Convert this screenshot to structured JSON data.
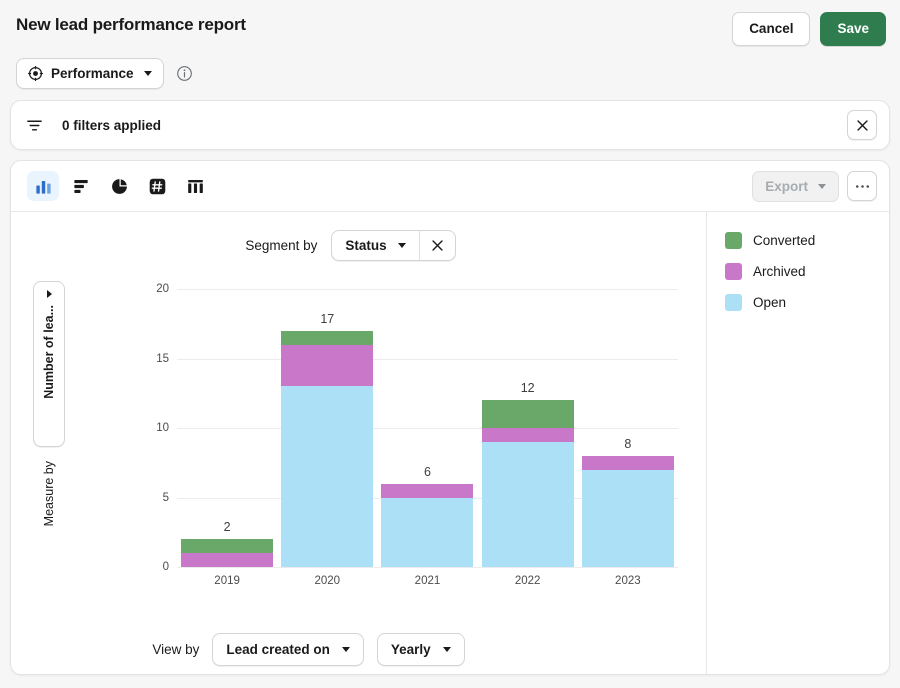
{
  "header": {
    "title": "New lead performance report",
    "cancel_label": "Cancel",
    "save_label": "Save"
  },
  "report_type": {
    "label": "Performance",
    "icon": "target-icon",
    "info_icon": "info-icon"
  },
  "filter_bar": {
    "icon": "filter-icon",
    "text": "0 filters applied",
    "close_icon": "close-icon"
  },
  "viz_toolbar": {
    "tabs": [
      {
        "name": "vertical-bar-chart",
        "active": true
      },
      {
        "name": "horizontal-bar-chart",
        "active": false
      },
      {
        "name": "pie-chart",
        "active": false
      },
      {
        "name": "single-number",
        "active": false
      },
      {
        "name": "table",
        "active": false
      }
    ],
    "export_label": "Export",
    "more_label": "···"
  },
  "segment": {
    "label": "Segment by",
    "value": "Status",
    "close_icon": "close-icon"
  },
  "measure": {
    "axis_label": "Number of lea...",
    "caption": "Measure by"
  },
  "view_by": {
    "label": "View by",
    "dimension": "Lead created on",
    "interval": "Yearly"
  },
  "legend": {
    "items": [
      {
        "label": "Converted",
        "color": "#6aa86a"
      },
      {
        "label": "Archived",
        "color": "#c977c9"
      },
      {
        "label": "Open",
        "color": "#ace0f7"
      }
    ]
  },
  "colors": {
    "brand_green": "#2f7d4f",
    "accent_blue": "#2c6ecb",
    "converted": "#6aa86a",
    "archived": "#c977c9",
    "open": "#ace0f7"
  },
  "chart_data": {
    "type": "bar",
    "stacked": true,
    "title": "",
    "xlabel": "",
    "ylabel": "Number of lea...",
    "categories": [
      "2019",
      "2020",
      "2021",
      "2022",
      "2023"
    ],
    "totals": [
      2,
      17,
      6,
      12,
      8
    ],
    "series": [
      {
        "name": "Open",
        "color": "#ace0f7",
        "values": [
          0,
          13,
          5,
          9,
          7
        ]
      },
      {
        "name": "Archived",
        "color": "#c977c9",
        "values": [
          1,
          3,
          1,
          1,
          1
        ]
      },
      {
        "name": "Converted",
        "color": "#6aa86a",
        "values": [
          1,
          1,
          0,
          2,
          0
        ]
      }
    ],
    "ylim": [
      0,
      20
    ],
    "yticks": [
      0,
      5,
      10,
      15,
      20
    ],
    "grid": true,
    "legend_position": "right"
  }
}
